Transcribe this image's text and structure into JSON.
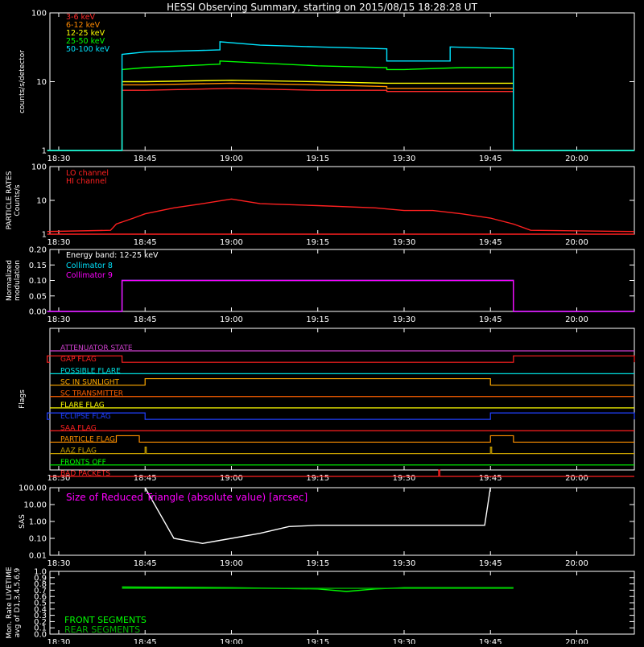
{
  "title": "HESSI Observing Summary, starting on 2015/08/15 18:28:28 UT",
  "time_ticks": [
    "18:30",
    "18:45",
    "19:00",
    "19:15",
    "19:30",
    "19:45",
    "20:00"
  ],
  "chart_data": [
    {
      "type": "line",
      "panel": "count-rates",
      "ylabel": "counts/s/detector",
      "yscale": "log",
      "ylim": [
        1,
        100
      ],
      "yticks": [
        "1",
        "10",
        "100"
      ],
      "x_range": [
        "18:28:28",
        "20:10:00"
      ],
      "series": [
        {
          "name": "3-6 keV",
          "color": "#ff2a2a",
          "x": [
            "18:28",
            "18:41",
            "18:41",
            "18:45",
            "19:00",
            "19:15",
            "19:27",
            "19:27",
            "19:30",
            "19:40",
            "19:49",
            "19:49",
            "20:10"
          ],
          "y": [
            1,
            1,
            7.5,
            7.5,
            8,
            7.5,
            7.5,
            7.2,
            7.2,
            7.2,
            7.2,
            1,
            1
          ]
        },
        {
          "name": "6-12 keV",
          "color": "#ff8a00",
          "x": [
            "18:28",
            "18:41",
            "18:41",
            "18:45",
            "19:00",
            "19:15",
            "19:27",
            "19:27",
            "19:30",
            "19:40",
            "19:49",
            "19:49",
            "20:10"
          ],
          "y": [
            1,
            1,
            9,
            9,
            9.5,
            9,
            8.5,
            8,
            8,
            8,
            8,
            1,
            1
          ]
        },
        {
          "name": "12-25 keV",
          "color": "#ffff00",
          "x": [
            "18:28",
            "18:41",
            "18:41",
            "18:45",
            "19:00",
            "19:15",
            "19:27",
            "19:27",
            "19:30",
            "19:40",
            "19:49",
            "19:49",
            "20:10"
          ],
          "y": [
            1,
            1,
            10,
            10,
            10.5,
            10,
            9.5,
            9.5,
            9.5,
            9.5,
            9.5,
            1,
            1
          ]
        },
        {
          "name": "25-50 keV",
          "color": "#00ff00",
          "x": [
            "18:28",
            "18:41",
            "18:41",
            "18:45",
            "18:58",
            "18:58",
            "19:15",
            "19:27",
            "19:27",
            "19:30",
            "19:40",
            "19:49",
            "19:49",
            "20:10"
          ],
          "y": [
            1,
            1,
            15,
            16,
            18,
            20,
            17,
            16,
            15,
            15,
            16,
            16,
            1,
            1
          ]
        },
        {
          "name": "50-100 keV",
          "color": "#00e5ff",
          "x": [
            "18:28",
            "18:41",
            "18:41",
            "18:45",
            "18:58",
            "18:58",
            "19:05",
            "19:15",
            "19:27",
            "19:27",
            "19:38",
            "19:38",
            "19:49",
            "19:49",
            "20:10"
          ],
          "y": [
            1,
            1,
            25,
            27,
            29,
            38,
            34,
            32,
            30,
            20,
            20,
            32,
            30,
            1,
            1
          ]
        }
      ]
    },
    {
      "type": "line",
      "panel": "particle-rates",
      "ylabel": "PARTICLE RATES Counts/s",
      "yscale": "log",
      "ylim": [
        1,
        100
      ],
      "yticks": [
        "1",
        "10",
        "100"
      ],
      "series": [
        {
          "name": "LO channel",
          "color": "#ff2020",
          "x": [
            "18:28",
            "20:10"
          ],
          "y": [
            1,
            1
          ]
        },
        {
          "name": "HI channel",
          "color": "#ff2020",
          "x": [
            "18:28",
            "18:39",
            "18:40",
            "18:43",
            "18:45",
            "18:50",
            "18:55",
            "19:00",
            "19:05",
            "19:15",
            "19:25",
            "19:30",
            "19:35",
            "19:40",
            "19:45",
            "19:49",
            "19:52",
            "20:10"
          ],
          "y": [
            1.2,
            1.3,
            2,
            3,
            4,
            6,
            8,
            11,
            8,
            7,
            6,
            5,
            5,
            4,
            3,
            2,
            1.3,
            1.2
          ]
        }
      ]
    },
    {
      "type": "line",
      "panel": "modulation",
      "annotation": "Energy band: 12-25 keV",
      "ylabel": "Normalized modulation",
      "ylim": [
        0,
        0.2
      ],
      "yticks": [
        "0.00",
        "0.05",
        "0.10",
        "0.15",
        "0.20"
      ],
      "series": [
        {
          "name": "Collimator 8",
          "color": "#00e5ff",
          "x": [
            "18:28",
            "18:41",
            "18:41",
            "19:49",
            "19:49",
            "20:10"
          ],
          "y": [
            0,
            0,
            0.1,
            0.1,
            0,
            0
          ]
        },
        {
          "name": "Collimator 9",
          "color": "#ff00ff",
          "x": [
            "18:28",
            "18:41",
            "18:41",
            "19:49",
            "19:49",
            "20:10"
          ],
          "y": [
            0,
            0,
            0.1,
            0.1,
            0,
            0
          ]
        }
      ]
    },
    {
      "type": "line",
      "panel": "flags",
      "ylabel": "Flags",
      "flags": [
        {
          "name": "ATTENUATOR STATE",
          "color": "#d040d0",
          "high": []
        },
        {
          "name": "GAP FLAG",
          "color": "#ff2020",
          "high": [
            [
              "18:28",
              "18:41"
            ],
            [
              "19:49",
              "20:10"
            ]
          ]
        },
        {
          "name": "POSSIBLE FLARE",
          "color": "#00e0e0",
          "high": []
        },
        {
          "name": "SC IN SUNLIGHT",
          "color": "#ffaa00",
          "high": [
            [
              "18:45",
              "19:45"
            ]
          ]
        },
        {
          "name": "SC TRANSMITTER",
          "color": "#ff6000",
          "high": []
        },
        {
          "name": "FLARE FLAG",
          "color": "#ffff00",
          "high": []
        },
        {
          "name": "ECLIPSE FLAG",
          "color": "#2040ff",
          "high": [
            [
              "18:28",
              "18:45"
            ],
            [
              "19:45",
              "20:10"
            ]
          ]
        },
        {
          "name": "SAA FLAG",
          "color": "#ff2020",
          "high": []
        },
        {
          "name": "PARTICLE FLAG",
          "color": "#ff9000",
          "high": [
            [
              "18:40",
              "18:44"
            ],
            [
              "19:45",
              "19:49"
            ]
          ]
        },
        {
          "name": "AAZ FLAG",
          "color": "#c8a000",
          "high": [
            [
              "18:45",
              "18:45"
            ],
            [
              "19:45",
              "19:45"
            ]
          ]
        },
        {
          "name": "FRONTS OFF",
          "color": "#00ff00",
          "high": []
        },
        {
          "name": "BAD PACKETS",
          "color": "#ff2020",
          "high": [
            [
              "19:36",
              "19:36"
            ]
          ]
        }
      ]
    },
    {
      "type": "line",
      "panel": "sas",
      "ylabel": "SAS",
      "annotation": "Size of Reduced Triangle (absolute value) [arcsec]",
      "yscale": "log",
      "ylim": [
        0.01,
        100
      ],
      "yticks": [
        "0.01",
        "0.10",
        "1.00",
        "10.00",
        "100.00"
      ],
      "series": [
        {
          "name": "SAS",
          "color": "#ffffff",
          "x": [
            "18:45",
            "18:50",
            "18:55",
            "19:00",
            "19:05",
            "19:10",
            "19:15",
            "19:30",
            "19:44",
            "19:45"
          ],
          "y": [
            100,
            0.1,
            0.05,
            0.1,
            0.2,
            0.5,
            0.6,
            0.6,
            0.6,
            100
          ]
        }
      ]
    },
    {
      "type": "line",
      "panel": "livetime",
      "ylabel": "Mon. Rate LIVETIME avg of D1,3,4,5,6,9",
      "ylim": [
        0,
        1
      ],
      "yticks": [
        "0.0",
        "0.1",
        "0.2",
        "0.3",
        "0.4",
        "0.5",
        "0.6",
        "0.7",
        "0.8",
        "0.9",
        "1.0"
      ],
      "series": [
        {
          "name": "FRONT SEGMENTS",
          "color": "#00ff00",
          "x": [
            "18:41",
            "19:00",
            "19:15",
            "19:20",
            "19:25",
            "19:30",
            "19:49"
          ],
          "y": [
            0.75,
            0.74,
            0.72,
            0.68,
            0.72,
            0.74,
            0.74
          ]
        },
        {
          "name": "REAR SEGMENTS",
          "color": "#00b000",
          "x": [
            "18:41",
            "19:49"
          ],
          "y": [
            0.73,
            0.73
          ]
        }
      ]
    }
  ]
}
